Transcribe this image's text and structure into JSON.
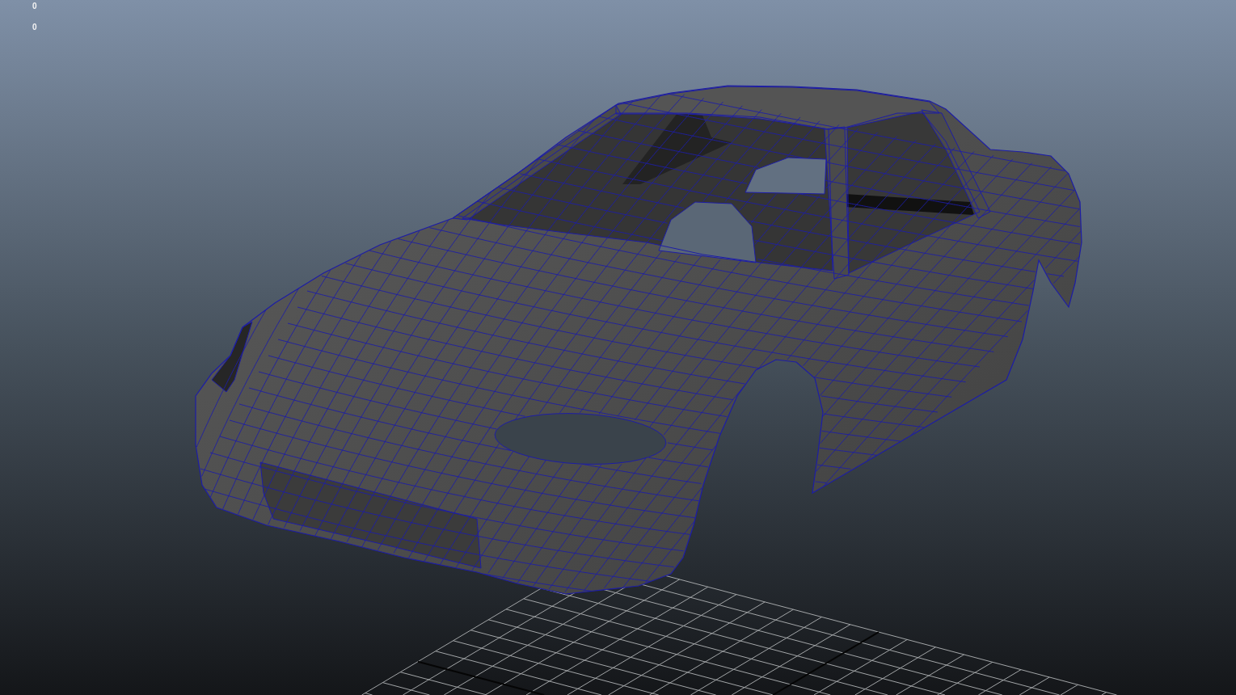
{
  "viewport": {
    "hud_readouts": [
      "0",
      "0"
    ]
  }
}
